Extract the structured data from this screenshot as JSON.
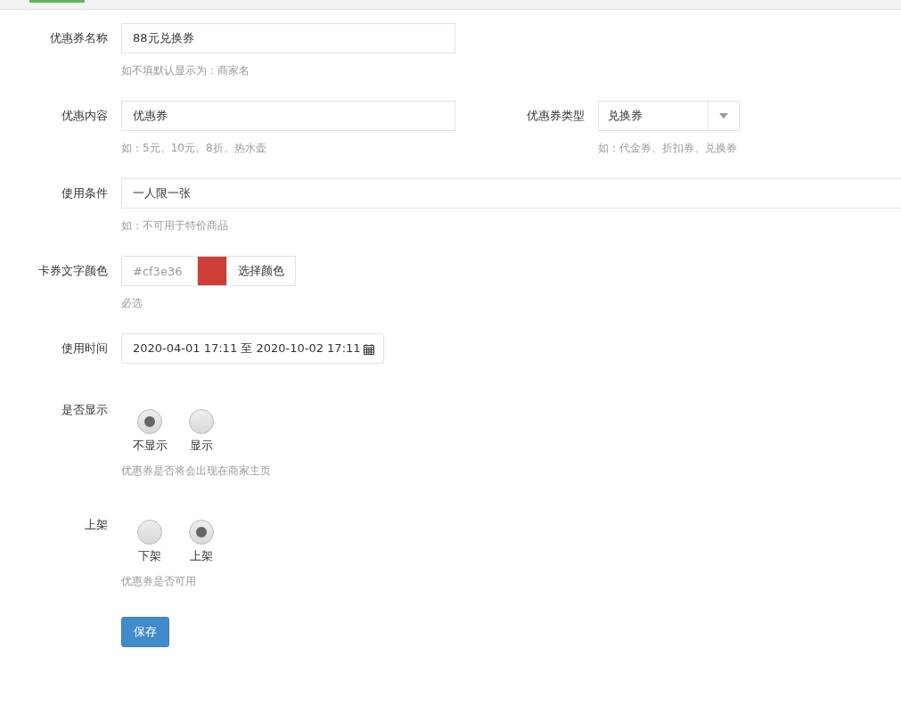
{
  "coupon_name": {
    "label": "优惠券名称",
    "value": "88元兑换券",
    "hint": "如不填默认显示为：商家名"
  },
  "content": {
    "label": "优惠内容",
    "value": "优惠券",
    "hint": "如：5元、10元、8折、热水壶"
  },
  "coupon_type": {
    "label": "优惠券类型",
    "value": "兑换券",
    "hint": "如：代金券、折扣券、兑换券"
  },
  "conditions": {
    "label": "使用条件",
    "value": "一人限一张",
    "hint": "如：不可用于特价商品"
  },
  "text_color": {
    "label": "卡券文字颜色",
    "placeholder": "#cf3e36",
    "color": "#cf3e36",
    "button": "选择颜色",
    "hint": "必选"
  },
  "use_time": {
    "label": "使用时间",
    "value": "2020-04-01 17:11 至 2020-10-02 17:11"
  },
  "radio_groups": [
    {
      "label": "是否显示",
      "options": [
        {
          "label": "不显示",
          "selected": true
        },
        {
          "label": "显示",
          "selected": false
        }
      ],
      "hint": "优惠券是否将会出现在商家主页"
    },
    {
      "label": "上架",
      "options": [
        {
          "label": "下架",
          "selected": false
        },
        {
          "label": "上架",
          "selected": true
        }
      ],
      "hint": "优惠券是否可用"
    }
  ],
  "save_button": "保存"
}
